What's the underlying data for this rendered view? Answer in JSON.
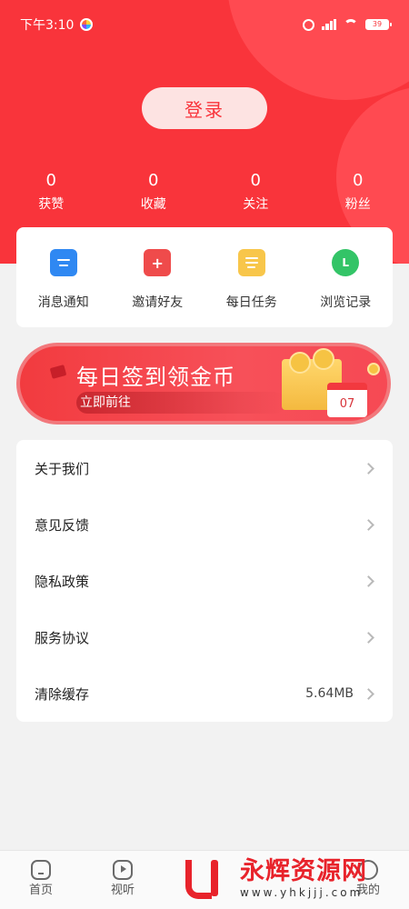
{
  "status_bar": {
    "time": "下午3:10",
    "battery": "39"
  },
  "login": {
    "label": "登录"
  },
  "stats": [
    {
      "value": "0",
      "label": "获赞"
    },
    {
      "value": "0",
      "label": "收藏"
    },
    {
      "value": "0",
      "label": "关注"
    },
    {
      "value": "0",
      "label": "粉丝"
    }
  ],
  "quick": [
    {
      "label": "消息通知",
      "icon": "message-icon"
    },
    {
      "label": "邀请好友",
      "icon": "invite-icon"
    },
    {
      "label": "每日任务",
      "icon": "task-icon"
    },
    {
      "label": "浏览记录",
      "icon": "history-icon"
    }
  ],
  "banner": {
    "title": "每日签到领金币",
    "subtitle": "立即前往",
    "calendar_day": "07"
  },
  "menu": [
    {
      "label": "关于我们",
      "value": ""
    },
    {
      "label": "意见反馈",
      "value": ""
    },
    {
      "label": "隐私政策",
      "value": ""
    },
    {
      "label": "服务协议",
      "value": ""
    },
    {
      "label": "清除缓存",
      "value": "5.64MB"
    }
  ],
  "nav": [
    {
      "label": "首页"
    },
    {
      "label": "视听"
    },
    {
      "label": "我的"
    }
  ],
  "watermark": {
    "title": "永辉资源网",
    "url": "www.yhkjjj.com"
  },
  "colors": {
    "primary": "#f9343b",
    "background": "#f2f2f2"
  }
}
